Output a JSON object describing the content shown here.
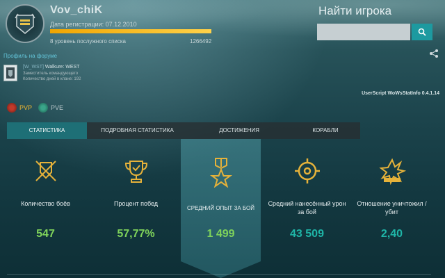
{
  "player": {
    "nickname": "Vov_chiK",
    "registration": "Дата регистрации: 07.12.2010",
    "progress_fraction": 1.0,
    "level_text": "8 уровень послужного списка",
    "experience": "1266492"
  },
  "search": {
    "title": "Найти игрока",
    "placeholder": "",
    "button_icon": "search-icon"
  },
  "share_icon": "share-icon",
  "forum_link": "Профиль на форуме",
  "clan": {
    "tag": "[W_WST]",
    "name": "Walkure: WEST",
    "role": "Заместитель командующего",
    "days": "Количество дней в клане: 192"
  },
  "userscript": "UserScript WoWsStatInfo 0.4.1.14",
  "modes": [
    {
      "label": "PVP",
      "active": true
    },
    {
      "label": "PVE",
      "active": false
    }
  ],
  "tabs": [
    {
      "label": "СТАТИСТИКА",
      "active": true
    },
    {
      "label": "ПОДРОБНАЯ СТАТИСТИКА",
      "active": false
    },
    {
      "label": "ДОСТИЖЕНИЯ",
      "active": false
    },
    {
      "label": "КОРАБЛИ",
      "active": false
    }
  ],
  "stats": [
    {
      "icon": "crossed-swords-shield-icon",
      "label": "Количество боёв",
      "value": "547"
    },
    {
      "icon": "trophy-cup-icon",
      "label": "Процент побед",
      "value": "57,77%"
    },
    {
      "icon": "star-medal-icon",
      "label": "СРЕДНИЙ ОПЫТ ЗА БОЙ",
      "value": "1 499"
    },
    {
      "icon": "crosshair-icon",
      "label": "Средний нанесённый урон за бой",
      "value": "43 509"
    },
    {
      "icon": "explosion-icon",
      "label": "Отношение уничтожил / убит",
      "value": "2,40"
    }
  ],
  "colors": {
    "accent": "#1d9aa0",
    "gold": "#f2b830",
    "green_value": "#7fd35b",
    "teal_value": "#1fb6a8"
  }
}
